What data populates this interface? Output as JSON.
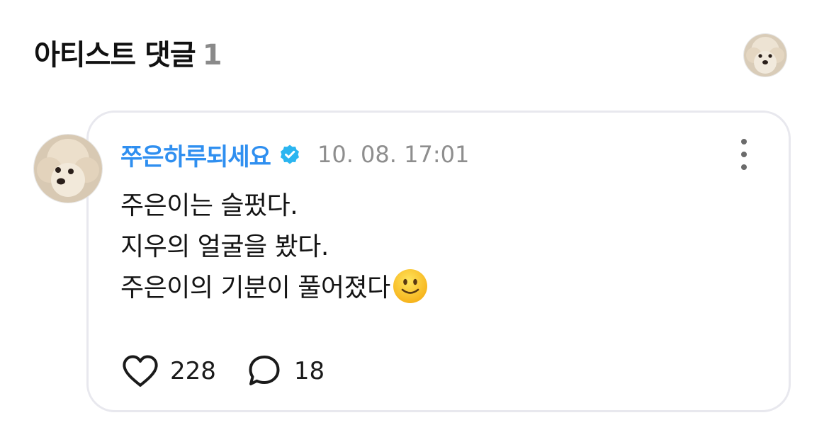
{
  "header": {
    "title": "아티스트 댓글",
    "count": "1",
    "avatar_icon": "dog-avatar-icon"
  },
  "comment": {
    "author": "쭈은하루되세요",
    "verified_icon": "verified-badge-icon",
    "timestamp": "10. 08. 17:01",
    "lines": [
      "주은이는 슬펐다.",
      "지우의 얼굴을 봤다.",
      "주은이의 기분이 풀어졌다"
    ],
    "emoji": "slightly-smiling-face-icon",
    "likes": "228",
    "replies": "18",
    "like_icon": "heart-icon",
    "reply_icon": "speech-bubble-icon",
    "more_icon": "more-vertical-icon"
  },
  "colors": {
    "author": "#2f8ff0",
    "verified": "#2bb5f0",
    "muted": "#8e8e8e",
    "card_border": "#e8e8ee"
  }
}
